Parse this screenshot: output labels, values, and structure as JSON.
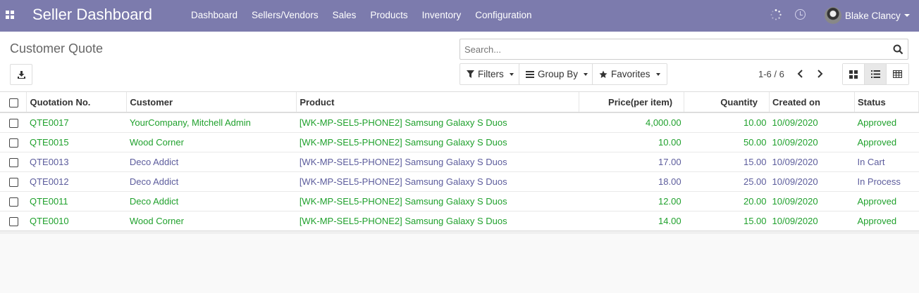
{
  "navbar": {
    "brand": "Seller Dashboard",
    "menu": [
      "Dashboard",
      "Sellers/Vendors",
      "Sales",
      "Products",
      "Inventory",
      "Configuration"
    ],
    "user": "Blake Clancy"
  },
  "control_panel": {
    "title": "Customer Quote",
    "search_placeholder": "Search...",
    "filters_label": "Filters",
    "groupby_label": "Group By",
    "favorites_label": "Favorites",
    "pager": "1-6 / 6"
  },
  "table": {
    "headers": [
      "Quotation No.",
      "Customer",
      "Product",
      "Price(per item)",
      "Quantity",
      "Created on",
      "Status"
    ],
    "rows": [
      {
        "quotation": "QTE0017",
        "customer": "YourCompany, Mitchell Admin",
        "product": "[WK-MP-SEL5-PHONE2] Samsung Galaxy S Duos",
        "price": "4,000.00",
        "quantity": "10.00",
        "created": "10/09/2020",
        "status": "Approved",
        "tone": "green"
      },
      {
        "quotation": "QTE0015",
        "customer": "Wood Corner",
        "product": "[WK-MP-SEL5-PHONE2] Samsung Galaxy S Duos",
        "price": "10.00",
        "quantity": "50.00",
        "created": "10/09/2020",
        "status": "Approved",
        "tone": "green"
      },
      {
        "quotation": "QTE0013",
        "customer": "Deco Addict",
        "product": "[WK-MP-SEL5-PHONE2] Samsung Galaxy S Duos",
        "price": "17.00",
        "quantity": "15.00",
        "created": "10/09/2020",
        "status": "In Cart",
        "tone": "blue"
      },
      {
        "quotation": "QTE0012",
        "customer": "Deco Addict",
        "product": "[WK-MP-SEL5-PHONE2] Samsung Galaxy S Duos",
        "price": "18.00",
        "quantity": "25.00",
        "created": "10/09/2020",
        "status": "In Process",
        "tone": "blue"
      },
      {
        "quotation": "QTE0011",
        "customer": "Deco Addict",
        "product": "[WK-MP-SEL5-PHONE2] Samsung Galaxy S Duos",
        "price": "12.00",
        "quantity": "20.00",
        "created": "10/09/2020",
        "status": "Approved",
        "tone": "green"
      },
      {
        "quotation": "QTE0010",
        "customer": "Wood Corner",
        "product": "[WK-MP-SEL5-PHONE2] Samsung Galaxy S Duos",
        "price": "14.00",
        "quantity": "15.00",
        "created": "10/09/2020",
        "status": "Approved",
        "tone": "green"
      }
    ]
  },
  "colors": {
    "navbar": "#7c7bad",
    "approved": "#20a12d",
    "pending": "#5c5c9c"
  }
}
